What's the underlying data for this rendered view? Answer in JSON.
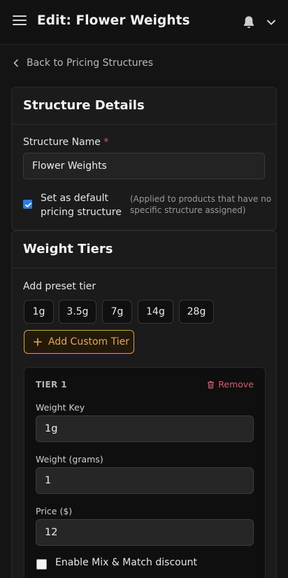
{
  "header": {
    "title": "Edit: Flower Weights",
    "menu_icon": "hamburger-menu-icon",
    "bell_icon": "bell-icon",
    "dropdown_icon": "chevron-down-icon"
  },
  "back_link": {
    "label": "Back to Pricing Structures",
    "icon": "chevron-left-icon"
  },
  "structure_details": {
    "heading": "Structure Details",
    "name_label": "Structure Name",
    "required_marker": "*",
    "name_value": "Flower Weights",
    "default_checkbox": {
      "checked": true,
      "label_line1": "Set as default",
      "label_line2": "pricing structure",
      "hint_line1": "(Applied to products that have no",
      "hint_line2": "specific structure assigned)"
    }
  },
  "weight_tiers": {
    "heading": "Weight Tiers",
    "preset_label": "Add preset tier",
    "presets": [
      "1g",
      "3.5g",
      "7g",
      "14g",
      "28g"
    ],
    "add_custom_label": "Add Custom Tier",
    "tiers": [
      {
        "title": "TIER 1",
        "remove_label": "Remove",
        "weight_key_label": "Weight Key",
        "weight_key_value": "1g",
        "weight_grams_label": "Weight (grams)",
        "weight_grams_value": "1",
        "price_label": "Price ($)",
        "price_value": "12",
        "mix_match_label": "Enable Mix & Match discount",
        "mix_match_checked": false
      }
    ]
  },
  "colors": {
    "accent": "#e3a84b",
    "danger": "#e0556a",
    "checkbox": "#2f7de1"
  }
}
